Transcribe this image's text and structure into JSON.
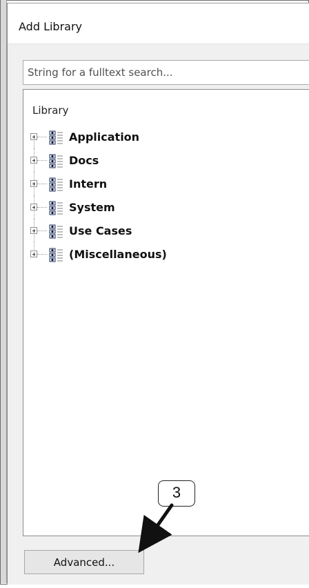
{
  "window": {
    "title": "Add Library"
  },
  "search": {
    "placeholder": "String for a fulltext search...",
    "value": ""
  },
  "tree": {
    "caption": "Library",
    "items": [
      {
        "label": "Application",
        "icon": "library-icon",
        "expanded": false
      },
      {
        "label": "Docs",
        "icon": "library-icon",
        "expanded": false
      },
      {
        "label": "Intern",
        "icon": "library-icon",
        "expanded": false
      },
      {
        "label": "System",
        "icon": "library-icon",
        "expanded": false
      },
      {
        "label": "Use Cases",
        "icon": "library-icon",
        "expanded": false
      },
      {
        "label": "(Miscellaneous)",
        "icon": "library-icon",
        "expanded": false
      }
    ]
  },
  "buttons": {
    "advanced": "Advanced..."
  },
  "annotation": {
    "callout_number": "3",
    "arrow_icon": "pointer-arrow-icon"
  },
  "colors": {
    "dialog_background": "#f0f0f0",
    "panel_background": "#ffffff",
    "border": "#8c8c8c"
  }
}
